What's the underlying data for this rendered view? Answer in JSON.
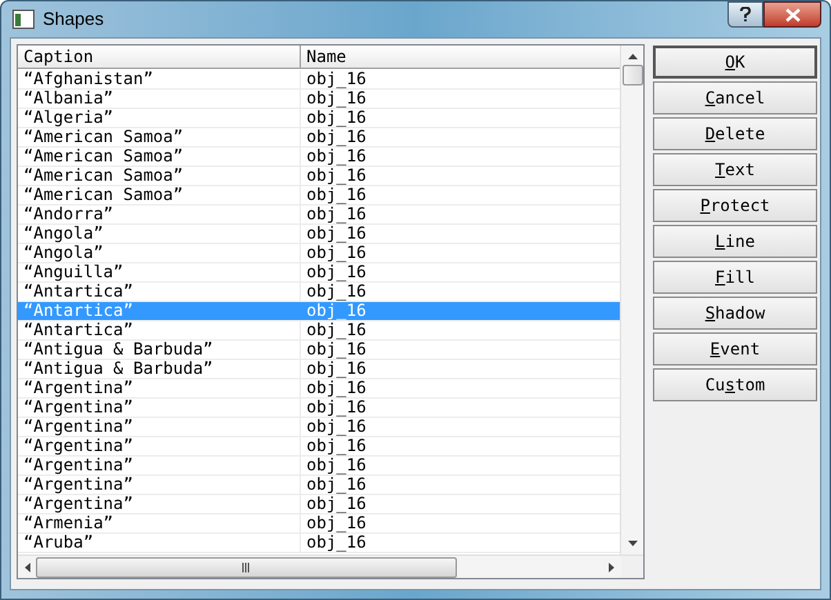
{
  "window": {
    "title": "Shapes"
  },
  "table": {
    "columns": [
      "Caption",
      "Name"
    ],
    "rows": [
      {
        "caption": "“Afghanistan”",
        "name": "obj_16",
        "selected": false
      },
      {
        "caption": "“Albania”",
        "name": "obj_16",
        "selected": false
      },
      {
        "caption": "“Algeria”",
        "name": "obj_16",
        "selected": false
      },
      {
        "caption": "“American Samoa”",
        "name": "obj_16",
        "selected": false
      },
      {
        "caption": "“American Samoa”",
        "name": "obj_16",
        "selected": false
      },
      {
        "caption": "“American Samoa”",
        "name": "obj_16",
        "selected": false
      },
      {
        "caption": "“American Samoa”",
        "name": "obj_16",
        "selected": false
      },
      {
        "caption": "“Andorra”",
        "name": "obj_16",
        "selected": false
      },
      {
        "caption": "“Angola”",
        "name": "obj_16",
        "selected": false
      },
      {
        "caption": "“Angola”",
        "name": "obj_16",
        "selected": false
      },
      {
        "caption": "“Anguilla”",
        "name": "obj_16",
        "selected": false
      },
      {
        "caption": "“Antartica”",
        "name": "obj_16",
        "selected": false
      },
      {
        "caption": "“Antartica”",
        "name": "obj_16",
        "selected": true
      },
      {
        "caption": "“Antartica”",
        "name": "obj_16",
        "selected": false
      },
      {
        "caption": "“Antigua & Barbuda”",
        "name": "obj_16",
        "selected": false
      },
      {
        "caption": "“Antigua & Barbuda”",
        "name": "obj_16",
        "selected": false
      },
      {
        "caption": "“Argentina”",
        "name": "obj_16",
        "selected": false
      },
      {
        "caption": "“Argentina”",
        "name": "obj_16",
        "selected": false
      },
      {
        "caption": "“Argentina”",
        "name": "obj_16",
        "selected": false
      },
      {
        "caption": "“Argentina”",
        "name": "obj_16",
        "selected": false
      },
      {
        "caption": "“Argentina”",
        "name": "obj_16",
        "selected": false
      },
      {
        "caption": "“Argentina”",
        "name": "obj_16",
        "selected": false
      },
      {
        "caption": "“Argentina”",
        "name": "obj_16",
        "selected": false
      },
      {
        "caption": "“Armenia”",
        "name": "obj_16",
        "selected": false
      },
      {
        "caption": "“Aruba”",
        "name": "obj_16",
        "selected": false
      }
    ]
  },
  "buttons": [
    {
      "key": "O",
      "post": "K",
      "default": true
    },
    {
      "key": "C",
      "post": "ancel",
      "default": false
    },
    {
      "key": "D",
      "post": "elete",
      "default": false
    },
    {
      "key": "T",
      "post": "ext",
      "default": false
    },
    {
      "key": "P",
      "post": "rotect",
      "default": false
    },
    {
      "key": "L",
      "post": "ine",
      "default": false
    },
    {
      "key": "F",
      "post": "ill",
      "default": false
    },
    {
      "key": "S",
      "post": "hadow",
      "default": false
    },
    {
      "key": "E",
      "post": "vent",
      "default": false
    },
    {
      "pre": "Cu",
      "key": "s",
      "post": "tom",
      "default": false
    }
  ]
}
